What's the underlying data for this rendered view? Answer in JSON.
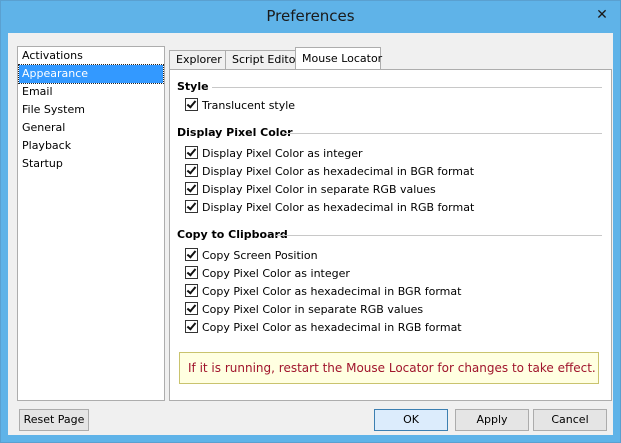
{
  "window": {
    "title": "Preferences"
  },
  "sidebar": {
    "items": [
      {
        "label": "Activations"
      },
      {
        "label": "Appearance"
      },
      {
        "label": "Email"
      },
      {
        "label": "File System"
      },
      {
        "label": "General"
      },
      {
        "label": "Playback"
      },
      {
        "label": "Startup"
      }
    ],
    "selected": "Appearance"
  },
  "tabs": [
    {
      "label": "Explorer"
    },
    {
      "label": "Script Editor"
    },
    {
      "label": "Mouse Locator"
    }
  ],
  "active_tab": "Mouse Locator",
  "style": {
    "heading": "Style",
    "items": [
      {
        "label": "Translucent style",
        "checked": true
      }
    ]
  },
  "display": {
    "heading": "Display Pixel Color",
    "items": [
      {
        "label": "Display Pixel Color as integer",
        "checked": true
      },
      {
        "label": "Display Pixel Color as hexadecimal in BGR format",
        "checked": true
      },
      {
        "label": "Display Pixel Color in separate RGB values",
        "checked": true
      },
      {
        "label": "Display Pixel Color as hexadecimal in RGB format",
        "checked": true
      }
    ]
  },
  "clipboard": {
    "heading": "Copy to Clipboard",
    "items": [
      {
        "label": "Copy Screen Position",
        "checked": true
      },
      {
        "label": "Copy Pixel Color as integer",
        "checked": true
      },
      {
        "label": "Copy Pixel Color as hexadecimal in BGR format",
        "checked": true
      },
      {
        "label": "Copy Pixel Color in separate RGB values",
        "checked": true
      },
      {
        "label": "Copy Pixel Color as hexadecimal in RGB format",
        "checked": true
      }
    ]
  },
  "note": "If it is running, restart the Mouse Locator for changes to take effect.",
  "buttons": {
    "reset": "Reset Page",
    "ok": "OK",
    "apply": "Apply",
    "cancel": "Cancel"
  },
  "colors": {
    "titlebar": "#5fb3e8",
    "selection": "#3399ff",
    "note_text": "#a0142c",
    "note_bg": "#ffffe1"
  }
}
